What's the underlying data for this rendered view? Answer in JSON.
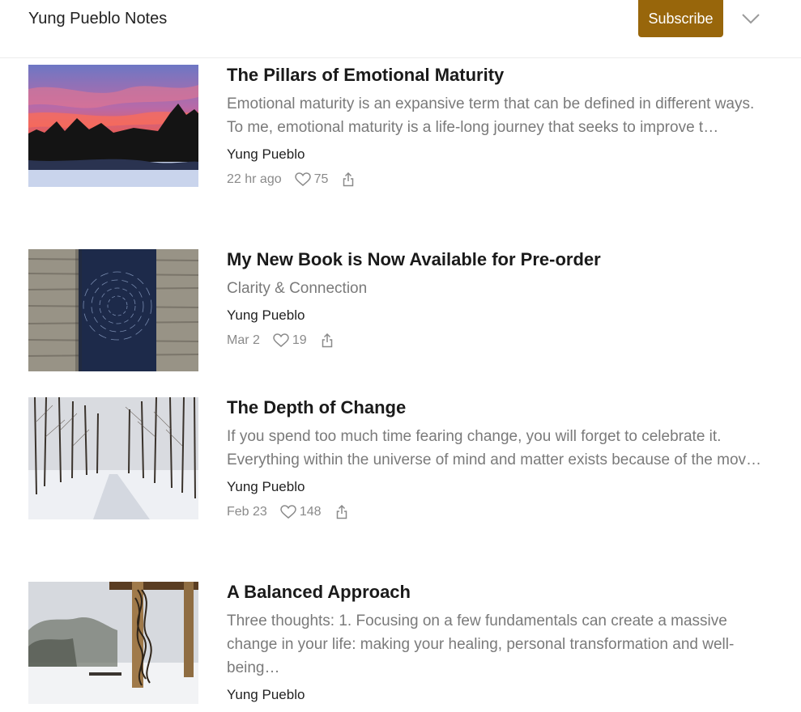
{
  "header": {
    "publication_title": "Yung Pueblo Notes",
    "subscribe_label": "Subscribe"
  },
  "posts": [
    {
      "title": "The Pillars of Emotional Maturity",
      "subtitle": "Emotional maturity is an expansive term that can be defined in different ways. To me, emotional maturity is a life-long journey that seeks to improve t…",
      "author": "Yung Pueblo",
      "date": "22 hr ago",
      "likes": "75",
      "thumbnail": "sunset-winter-forest"
    },
    {
      "title": "My New Book is Now Available for Pre-order",
      "subtitle": "Clarity & Connection",
      "author": "Yung Pueblo",
      "date": "Mar 2",
      "likes": "19",
      "thumbnail": "book-cover-on-wood"
    },
    {
      "title": "The Depth of Change",
      "subtitle": "If you spend too much time fearing change, you will forget to celebrate it. Everything within the universe of mind and matter exists because of the mov…",
      "author": "Yung Pueblo",
      "date": "Feb 23",
      "likes": "148",
      "thumbnail": "snowy-forest-road"
    },
    {
      "title": "A Balanced Approach",
      "subtitle": "Three thoughts: 1. Focusing on a few fundamentals can create a massive change in your life: making your healing, personal transformation and well-being…",
      "author": "Yung Pueblo",
      "date": "",
      "likes": "",
      "thumbnail": "snowy-pergola"
    }
  ],
  "colors": {
    "accent": "#98660b",
    "subtitle_gray": "#7a7a7a",
    "meta_gray": "#8a8a8a"
  }
}
